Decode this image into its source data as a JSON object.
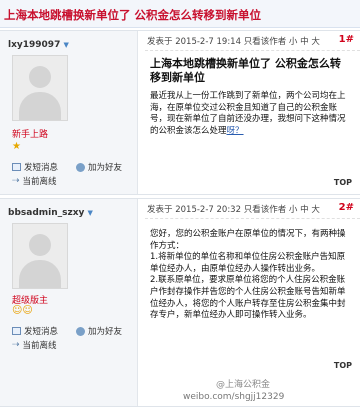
{
  "thread": {
    "title": "上海本地跳槽换新单位了 公积金怎么转移到新单位"
  },
  "post_ui": {
    "time_prefix": "发表于",
    "only_author": "只看该作者",
    "font_sizes": [
      "小",
      "中",
      "大"
    ],
    "top_label": "TOP",
    "send_message": "发短消息",
    "add_friend": "加为好友",
    "status": "当前离线"
  },
  "posts": [
    {
      "author": "lxy199097",
      "rank": "新手上路",
      "rank_icons": "★",
      "time": "2015-2-7 19:14",
      "floor": "1",
      "heading": "上海本地跳槽换新单位了 公积金怎么转移到新单位",
      "body": [
        "最近我从上一份工作跳到了新单位，两个公司均在上海，在原单位交过公积金且知道了自己的公积金账号，现在新单位了自前还没办理，我想问下这种情况的公积金该怎么处理",
        "呀？"
      ]
    },
    {
      "author": "bbsadmin_szxy",
      "rank": "超级版主",
      "rank_icons": "☺☺",
      "time": "2015-2-7 20:32",
      "floor": "2",
      "body": [
        "您好，您的公积金账户在原单位的情况下，有两种操作方式：",
        "1.将新单位的单位名称和单位住房公积金账户告知原单位经办人，由原单位经办人操作转出业务。",
        "2.联系原单位，要求原单位将您的个人住房公积金账户作封存操作并告您的个人住房公积金账号告知新单位经办人，将您的个人账户转存至住房公积金集中封存专户，新单位经办人即可操作转入业务。"
      ]
    }
  ],
  "watermark": {
    "logo_text": "@上海公积金",
    "url": "weibo.com/shgjj12329"
  }
}
